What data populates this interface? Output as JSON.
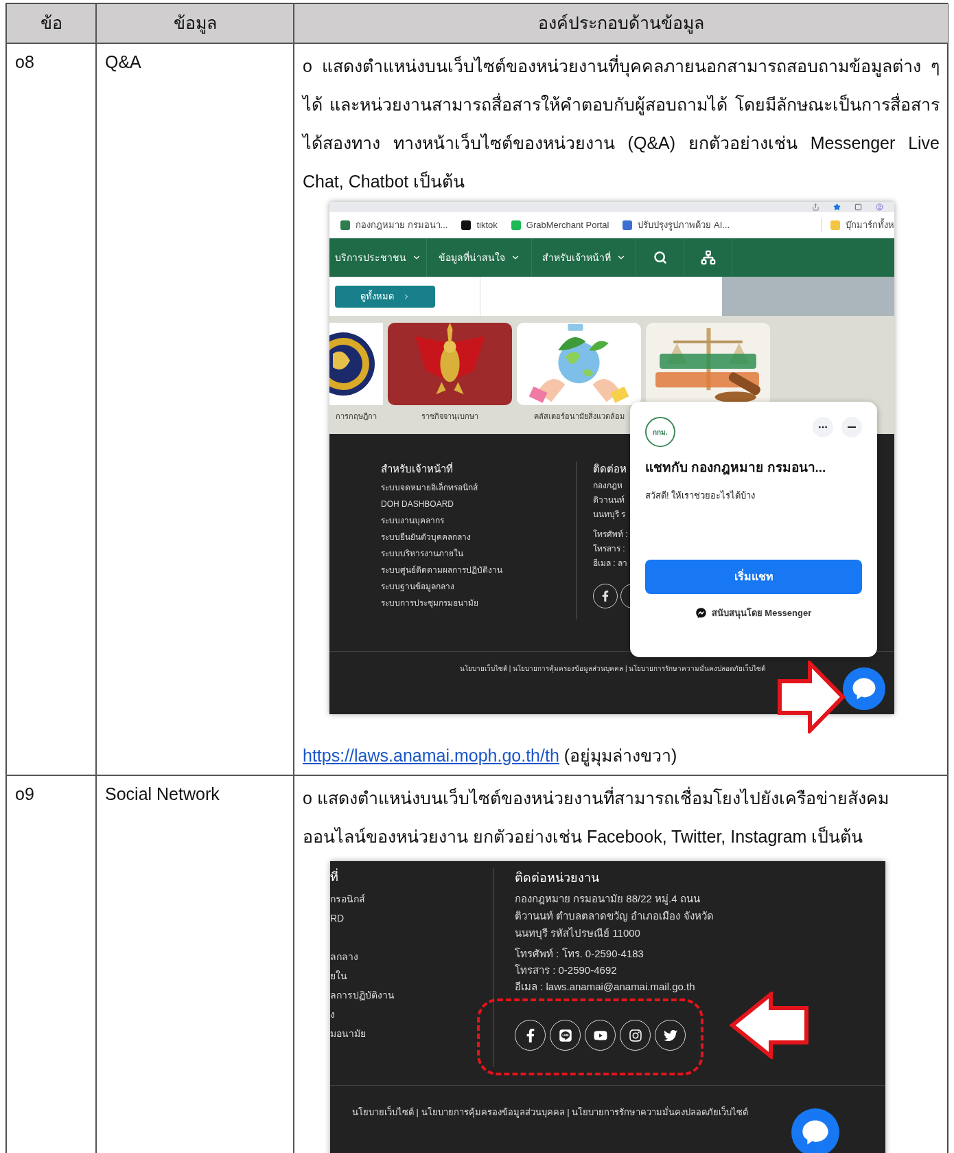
{
  "table": {
    "columns": [
      "ข้อ",
      "ข้อมูล",
      "องค์ประกอบด้านข้อมูล"
    ],
    "rows": [
      {
        "number": "o8",
        "item": "Q&A",
        "description": "o แสดงตำแหน่งบนเว็บไซต์ของหน่วยงานที่บุคคลภายนอกสามารถสอบถามข้อมูลต่าง ๆ ได้ และหน่วยงานสามารถสื่อสารให้คำตอบกับผู้สอบถามได้ โดยมีลักษณะเป็นการสื่อสารได้สองทาง ทางหน้าเว็บไซต์ของหน่วยงาน (Q&A) ยกตัวอย่างเช่น Messenger Live Chat, Chatbot เป็นต้น",
        "screenshot": {
          "bookmarks": [
            {
              "label": "กองกฎหมาย กรมอนา...",
              "color": "#2e7d4f"
            },
            {
              "label": "tiktok",
              "color": "#111111"
            },
            {
              "label": "GrabMerchant Portal",
              "color": "#1db954"
            },
            {
              "label": "ปรับปรุงรูปภาพด้วย AI...",
              "color": "#3b6fd1"
            },
            {
              "label": "บุ๊กมาร์กทั้งห",
              "color": "#f4c542"
            }
          ],
          "nav": [
            "บริการประชาชน",
            "ข้อมูลที่น่าสนใจ",
            "สำหรับเจ้าหน้าที่"
          ],
          "view_all_button": "ดูทั้งหมด",
          "cards": [
            {
              "caption": "การกฤษฎีกา"
            },
            {
              "caption": "ราชกิจจานุเบกษา"
            },
            {
              "caption": "คลัสเตอร์อนามัยสิ่งแวดล้อม"
            },
            {
              "kind": "picture"
            }
          ],
          "staff_title": "สำหรับเจ้าหน้าที่",
          "staff_links": [
            "ระบบจดหมายอิเล็กทรอนิกส์",
            "DOH DASHBOARD",
            "ระบบงานบุคลากร",
            "ระบบยืนยันตัวบุคคลกลาง",
            "ระบบบริหารงานภายใน",
            "ระบบศูนย์ติดตามผลการปฏิบัติงาน",
            "ระบบฐานข้อมูลกลาง",
            "ระบบการประชุมกรมอนามัย"
          ],
          "contact_title": "ติดต่อห",
          "contact_lines": [
            "กองกฎห",
            "ติวานนท์",
            "นนทบุรี ร",
            "โทรศัพท์ :",
            "โทรสาร :",
            "อีเมล : ลา"
          ],
          "policy": "นโยบายเว็บไซต์ | นโยบายการคุ้มครองข้อมูลส่วนบุคคล | นโยบายการรักษาความมั่นคงปลอดภัยเว็บไซต์",
          "chat": {
            "logo": "กกม.",
            "title": "แชทกับ กองกฎหมาย กรมอนา...",
            "greeting": "สวัสดี! ให้เราช่วยอะไรได้บ้าง",
            "button": "เริ่มแชท",
            "powered_by": "สนับสนุนโดย Messenger"
          }
        },
        "link": "https://laws.anamai.moph.go.th/th",
        "link_note": "(อยู่มุมล่างขวา)"
      },
      {
        "number": "o9",
        "item": "Social Network",
        "description": "o แสดงตำแหน่งบนเว็บไซต์ของหน่วยงานที่สามารถเชื่อมโยงไปยังเครือข่ายสังคมออนไลน์ของหน่วยงาน ยกตัวอย่างเช่น Facebook, Twitter, Instagram เป็นต้น",
        "screenshot": {
          "staff_title": "ที่",
          "staff_links": [
            "กรอนิกส์",
            "RD",
            "ลกลาง",
            "ยใน",
            "ลการปฏิบัติงาน",
            "ง",
            "มอนามัย"
          ],
          "contact_title": "ติดต่อหน่วยงาน",
          "address_lines": [
            "กองกฎหมาย กรมอนามัย 88/22 หมู่.4 ถนน",
            "ติวานนท์ ตำบลตลาดขวัญ อำเภอเมือง จังหวัด",
            "นนทบุรี รหัสไปรษณีย์ 11000"
          ],
          "contact_lines": [
            "โทรศัพท์ : โทร. 0-2590-4183",
            "โทรสาร : 0-2590-4692",
            "อีเมล : laws.anamai@anamai.mail.go.th"
          ],
          "social": [
            {
              "kind": "facebook"
            },
            {
              "kind": "line"
            },
            {
              "kind": "youtube"
            },
            {
              "kind": "instagram"
            },
            {
              "kind": "twitter"
            }
          ],
          "policy": "นโยบายเว็บไซต์ | นโยบายการคุ้มครองข้อมูลส่วนบุคคล | นโยบายการรักษาความมั่นคงปลอดภัยเว็บไซต์"
        }
      }
    ]
  }
}
